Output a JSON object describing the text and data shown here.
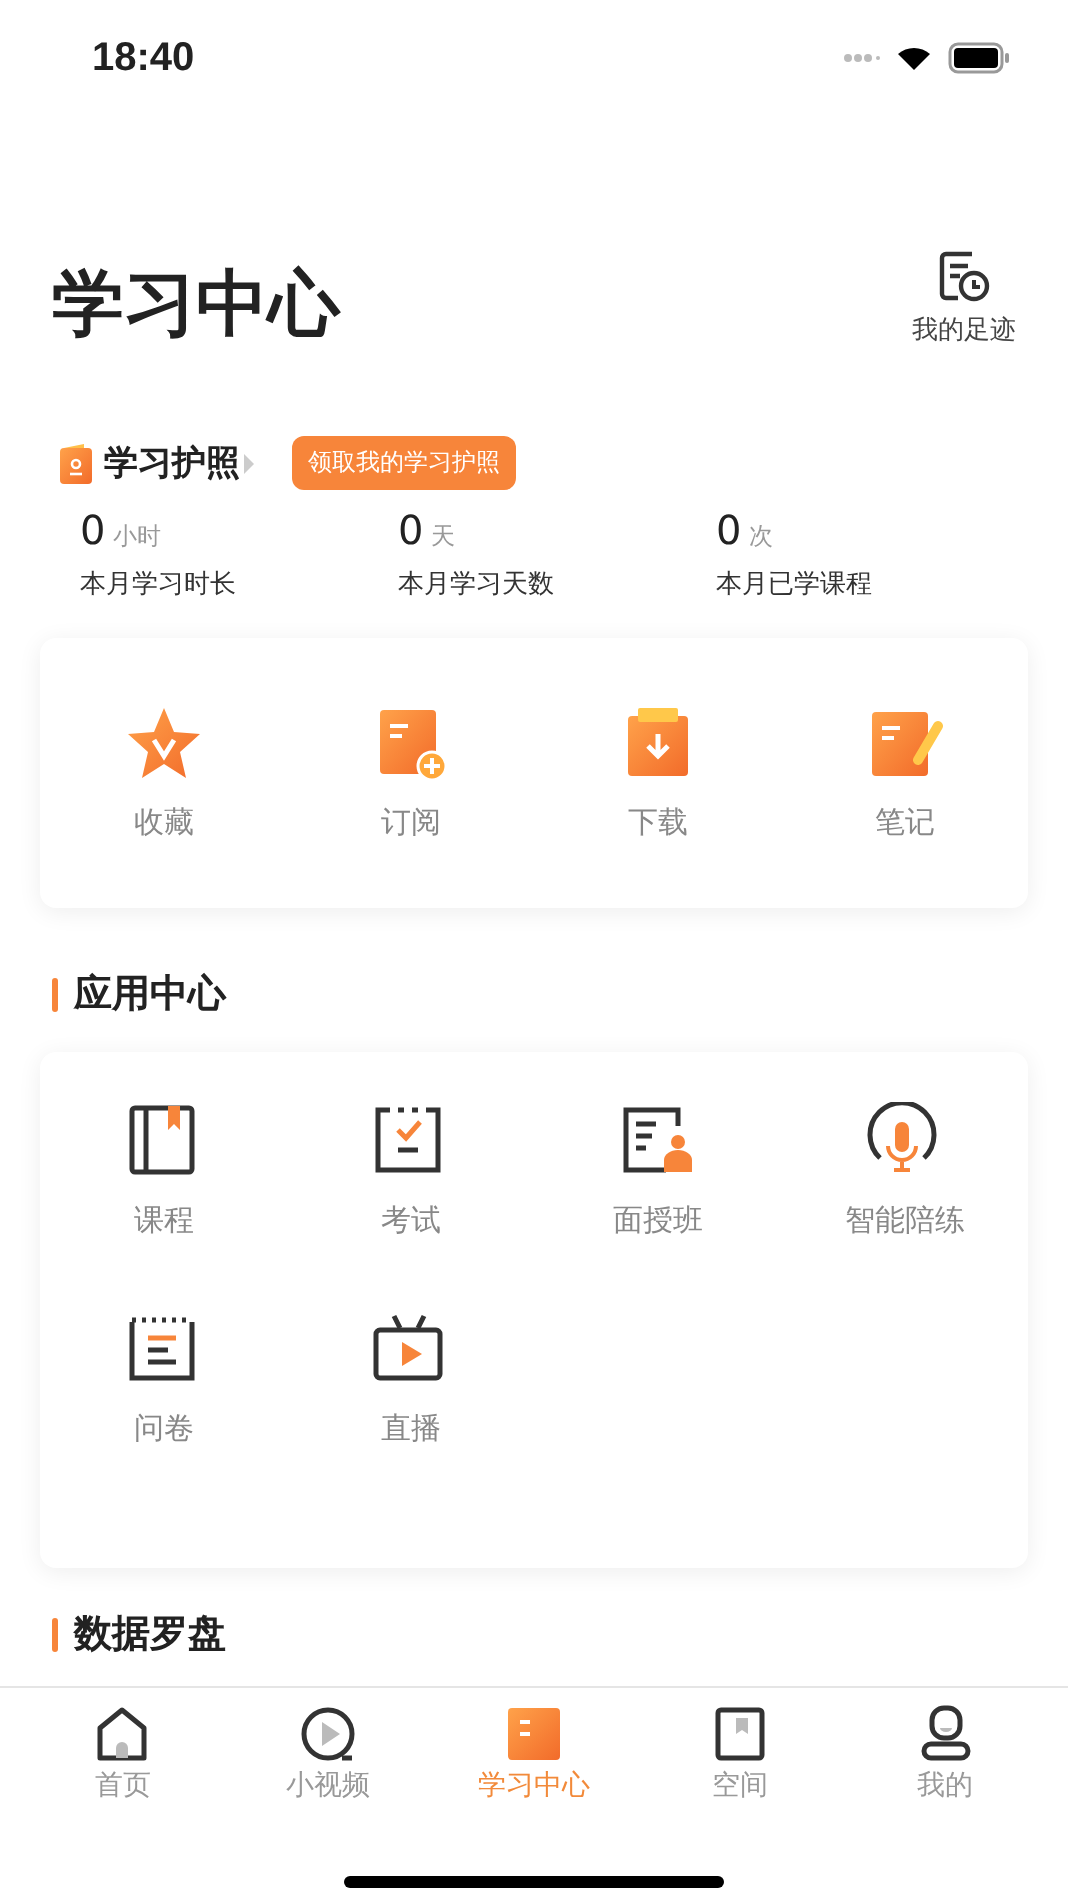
{
  "status_bar": {
    "time": "18:40"
  },
  "header": {
    "title": "学习中心",
    "footprint": {
      "label": "我的足迹"
    }
  },
  "passport": {
    "title": "学习护照",
    "tip": "领取我的学习护照"
  },
  "stats": [
    {
      "value": "0",
      "unit": "小时",
      "label": "本月学习时长"
    },
    {
      "value": "0",
      "unit": "天",
      "label": "本月学习天数"
    },
    {
      "value": "0",
      "unit": "次",
      "label": "本月已学课程"
    }
  ],
  "shortcuts": [
    {
      "kind": "star",
      "label": "收藏"
    },
    {
      "kind": "subscribe",
      "label": "订阅"
    },
    {
      "kind": "download",
      "label": "下载"
    },
    {
      "kind": "note",
      "label": "笔记"
    }
  ],
  "apps": {
    "title": "应用中心",
    "items": [
      {
        "kind": "course",
        "label": "课程"
      },
      {
        "kind": "exam",
        "label": "考试"
      },
      {
        "kind": "class",
        "label": "面授班"
      },
      {
        "kind": "mic",
        "label": "智能陪练"
      },
      {
        "kind": "survey",
        "label": "问卷"
      },
      {
        "kind": "live",
        "label": "直播"
      }
    ]
  },
  "data_section": {
    "title": "数据罗盘"
  },
  "tab_bar": [
    {
      "kind": "home",
      "label": "首页",
      "selected": false
    },
    {
      "kind": "video",
      "label": "小视频",
      "selected": false
    },
    {
      "kind": "study",
      "label": "学习中心",
      "selected": true
    },
    {
      "kind": "space",
      "label": "空间",
      "selected": false
    },
    {
      "kind": "me",
      "label": "我的",
      "selected": false
    }
  ]
}
